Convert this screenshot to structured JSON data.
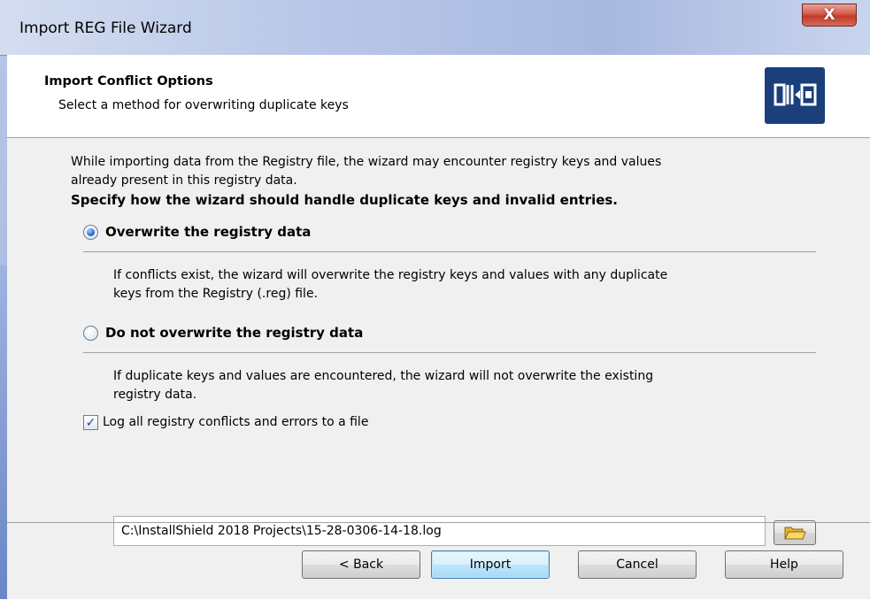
{
  "window": {
    "title": "Import REG File Wizard",
    "close_glyph": "X"
  },
  "header": {
    "title": "Import Conflict Options",
    "subtitle": "Select a method for overwriting duplicate keys",
    "logo_icon": "installshield-wizard-icon",
    "logo_color": "#1a3f7a"
  },
  "body": {
    "intro_line1": "While importing data from the Registry file, the wizard may encounter registry keys and values",
    "intro_line2": "already present in this registry data.",
    "instruction": "Specify how the wizard should handle duplicate keys and invalid entries.",
    "options": [
      {
        "label": "Overwrite the registry data",
        "selected": true,
        "description_line1": "If conflicts exist, the wizard will overwrite the registry keys and values with any duplicate",
        "description_line2": "keys from the Registry (.reg) file."
      },
      {
        "label": "Do not overwrite the registry data",
        "selected": false,
        "description_line1": "If duplicate keys and values are encountered, the wizard will not overwrite the existing",
        "description_line2": "registry data."
      }
    ],
    "log_checkbox": {
      "label": "Log all registry conflicts and errors to a file",
      "checked": true
    },
    "log_path": {
      "value": "C:\\InstallShield 2018 Projects\\15-28-0306-14-18.log",
      "browse_icon": "folder-icon"
    }
  },
  "buttons": {
    "back": "< Back",
    "import": "Import",
    "cancel": "Cancel",
    "help": "Help"
  },
  "colors": {
    "accent": "#3c7fb1",
    "close_red": "#c13a2a",
    "folder_yellow": "#f2c64a"
  }
}
